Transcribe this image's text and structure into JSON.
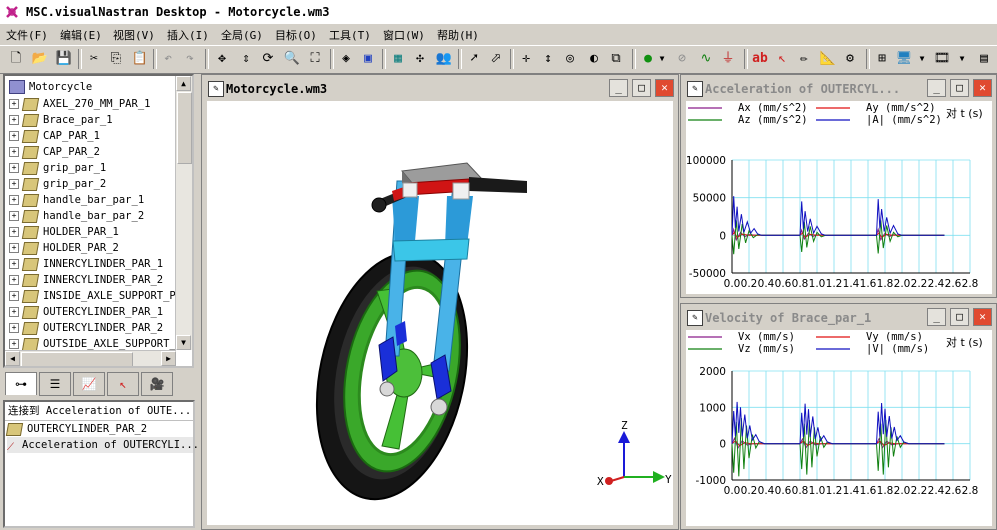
{
  "app": {
    "title": "MSC.visualNastran Desktop - Motorcycle.wm3"
  },
  "menu": [
    {
      "label": "文件(F)"
    },
    {
      "label": "编辑(E)"
    },
    {
      "label": "视图(V)"
    },
    {
      "label": "插入(I)"
    },
    {
      "label": "全局(G)"
    },
    {
      "label": "目标(O)"
    },
    {
      "label": "工具(T)"
    },
    {
      "label": "窗口(W)"
    },
    {
      "label": "帮助(H)"
    }
  ],
  "toolbar": {
    "icons": [
      "new-icon",
      "open-icon",
      "save-icon",
      "cut-icon",
      "copy-icon",
      "paste-icon",
      "undo-icon",
      "redo-icon",
      "move-icon",
      "pan-icon",
      "rotate-icon",
      "zoom-icon",
      "zoom-fit-icon",
      "render-icon",
      "box-icon",
      "grid-icon",
      "joint-icon",
      "people-icon",
      "pointer-icon",
      "select-icon",
      "translate-icon",
      "vertical-arrows-icon",
      "orbit-icon",
      "camera-icon",
      "frame-icon",
      "dot-icon",
      "hide-icon",
      "spring-icon",
      "constraint-icon",
      "text-icon",
      "arrow-icon",
      "measure-icon",
      "ruler-icon",
      "script-icon",
      "layout-icon",
      "screen-icon",
      "film-icon",
      "options-icon"
    ]
  },
  "tree": {
    "root": "Motorcycle",
    "items": [
      "AXEL_270_MM_PAR_1",
      "Brace_par_1",
      "CAP_PAR_1",
      "CAP_PAR_2",
      "grip_par_1",
      "grip_par_2",
      "handle_bar_par_1",
      "handle_bar_par_2",
      "HOLDER_PAR_1",
      "HOLDER_PAR_2",
      "INNERCYLINDER_PAR_1",
      "INNERCYLINDER_PAR_2",
      "INSIDE_AXLE_SUPPORT_PAR",
      "OUTERCYLINDER_PAR_1",
      "OUTERCYLINDER_PAR_2",
      "OUTSIDE_AXLE_SUPPORT_PAR"
    ]
  },
  "tabs": [
    "tree-tab",
    "list-tab",
    "graph-tab",
    "constraint-tab",
    "camera-tab"
  ],
  "connections": {
    "header": "连接到 Acceleration of OUTE...",
    "items": [
      {
        "label": "OUTERCYLINDER_PAR_2",
        "icon": "part-icon"
      },
      {
        "label": "Acceleration of OUTERCYLI...",
        "icon": "graph-icon"
      }
    ]
  },
  "viewport": {
    "title": "Motorcycle.wm3",
    "axis": {
      "x": "X",
      "y": "Y",
      "z": "Z"
    }
  },
  "colors": {
    "accent_red": "#e04a30",
    "series": [
      "#8b1c8b",
      "#e01010",
      "#108010",
      "#1010c0"
    ],
    "grid": "#80e0f0"
  },
  "chart_data": [
    {
      "type": "line",
      "window_title": "Acceleration of OUTERCYL...",
      "legend": [
        "Ax (mm/s^2)",
        "Ay (mm/s^2)",
        "Az (mm/s^2)",
        "|A| (mm/s^2)"
      ],
      "xlabel": "对 t (s)",
      "x_ticks": [
        "0.0",
        "0.2",
        "0.4",
        "0.6",
        "0.8",
        "1.0",
        "1.2",
        "1.4",
        "1.6",
        "1.8",
        "2.0",
        "2.2",
        "2.4",
        "2.6",
        "2.8"
      ],
      "y_ticks": [
        "100000",
        "50000",
        "0",
        "-50000"
      ],
      "ylim": [
        -50000,
        100000
      ],
      "xlim": [
        0,
        2.8
      ],
      "series": [
        {
          "name": "Ax (mm/s^2)",
          "values": [
            [
              0.0,
              0
            ],
            [
              0.02,
              8000
            ],
            [
              0.05,
              -6000
            ],
            [
              0.1,
              4000
            ],
            [
              0.15,
              -2000
            ],
            [
              0.2,
              1000
            ],
            [
              0.3,
              0
            ],
            [
              0.8,
              0
            ],
            [
              0.82,
              7000
            ],
            [
              0.85,
              -5000
            ],
            [
              0.9,
              3000
            ],
            [
              0.95,
              -1500
            ],
            [
              1.0,
              800
            ],
            [
              1.1,
              0
            ],
            [
              1.7,
              0
            ],
            [
              1.72,
              8000
            ],
            [
              1.75,
              -6000
            ],
            [
              1.8,
              3000
            ],
            [
              1.85,
              -1500
            ],
            [
              1.9,
              800
            ],
            [
              2.0,
              0
            ],
            [
              2.5,
              0
            ]
          ]
        },
        {
          "name": "Ay (mm/s^2)",
          "values": [
            [
              0.0,
              0
            ],
            [
              0.03,
              4000
            ],
            [
              0.06,
              -3000
            ],
            [
              0.12,
              1500
            ],
            [
              0.2,
              0
            ],
            [
              0.8,
              0
            ],
            [
              0.83,
              3000
            ],
            [
              0.86,
              -2500
            ],
            [
              0.92,
              1200
            ],
            [
              1.0,
              0
            ],
            [
              1.7,
              0
            ],
            [
              1.73,
              3000
            ],
            [
              1.76,
              -2500
            ],
            [
              1.82,
              1200
            ],
            [
              1.9,
              0
            ],
            [
              2.5,
              0
            ]
          ]
        },
        {
          "name": "Az (mm/s^2)",
          "values": [
            [
              0.0,
              0
            ],
            [
              0.02,
              -25000
            ],
            [
              0.05,
              20000
            ],
            [
              0.08,
              -18000
            ],
            [
              0.12,
              15000
            ],
            [
              0.16,
              -10000
            ],
            [
              0.2,
              6000
            ],
            [
              0.25,
              -3000
            ],
            [
              0.3,
              1000
            ],
            [
              0.35,
              0
            ],
            [
              0.8,
              0
            ],
            [
              0.82,
              -22000
            ],
            [
              0.85,
              18000
            ],
            [
              0.88,
              -16000
            ],
            [
              0.92,
              12000
            ],
            [
              0.96,
              -8000
            ],
            [
              1.0,
              4000
            ],
            [
              1.05,
              -2000
            ],
            [
              1.1,
              0
            ],
            [
              1.7,
              0
            ],
            [
              1.72,
              -24000
            ],
            [
              1.75,
              20000
            ],
            [
              1.78,
              -17000
            ],
            [
              1.82,
              13000
            ],
            [
              1.86,
              -8000
            ],
            [
              1.9,
              4000
            ],
            [
              1.95,
              -2000
            ],
            [
              2.0,
              0
            ],
            [
              2.5,
              0
            ]
          ]
        },
        {
          "name": "|A| (mm/s^2)",
          "values": [
            [
              0.0,
              0
            ],
            [
              0.02,
              52000
            ],
            [
              0.04,
              10000
            ],
            [
              0.06,
              38000
            ],
            [
              0.08,
              5000
            ],
            [
              0.11,
              28000
            ],
            [
              0.14,
              4000
            ],
            [
              0.18,
              18000
            ],
            [
              0.22,
              3000
            ],
            [
              0.26,
              9000
            ],
            [
              0.3,
              2000
            ],
            [
              0.35,
              0
            ],
            [
              0.8,
              0
            ],
            [
              0.82,
              45000
            ],
            [
              0.84,
              8000
            ],
            [
              0.86,
              32000
            ],
            [
              0.89,
              5000
            ],
            [
              0.92,
              22000
            ],
            [
              0.96,
              3000
            ],
            [
              1.0,
              12000
            ],
            [
              1.05,
              2000
            ],
            [
              1.1,
              0
            ],
            [
              1.7,
              0
            ],
            [
              1.72,
              48000
            ],
            [
              1.74,
              9000
            ],
            [
              1.76,
              35000
            ],
            [
              1.79,
              5000
            ],
            [
              1.82,
              24000
            ],
            [
              1.86,
              3000
            ],
            [
              1.9,
              13000
            ],
            [
              1.95,
              2000
            ],
            [
              2.0,
              0
            ],
            [
              2.5,
              0
            ]
          ]
        }
      ]
    },
    {
      "type": "line",
      "window_title": "Velocity of Brace_par_1",
      "legend": [
        "Vx (mm/s)",
        "Vy (mm/s)",
        "Vz (mm/s)",
        "|V| (mm/s)"
      ],
      "xlabel": "对 t (s)",
      "x_ticks": [
        "0.0",
        "0.2",
        "0.4",
        "0.6",
        "0.8",
        "1.0",
        "1.2",
        "1.4",
        "1.6",
        "1.8",
        "2.0",
        "2.2",
        "2.4",
        "2.6",
        "2.8"
      ],
      "y_ticks": [
        "2000",
        "1000",
        "0",
        "-1000"
      ],
      "ylim": [
        -1000,
        2000
      ],
      "xlim": [
        0,
        2.8
      ],
      "series": [
        {
          "name": "Vx (mm/s)",
          "values": [
            [
              0.0,
              0
            ],
            [
              0.03,
              150
            ],
            [
              0.07,
              -120
            ],
            [
              0.12,
              80
            ],
            [
              0.18,
              -40
            ],
            [
              0.25,
              0
            ],
            [
              0.8,
              0
            ],
            [
              0.83,
              130
            ],
            [
              0.87,
              -110
            ],
            [
              0.92,
              70
            ],
            [
              0.98,
              -30
            ],
            [
              1.05,
              0
            ],
            [
              1.7,
              0
            ],
            [
              1.73,
              140
            ],
            [
              1.77,
              -110
            ],
            [
              1.82,
              70
            ],
            [
              1.88,
              -30
            ],
            [
              1.95,
              0
            ],
            [
              2.5,
              0
            ]
          ]
        },
        {
          "name": "Vy (mm/s)",
          "values": [
            [
              0.0,
              0
            ],
            [
              0.04,
              80
            ],
            [
              0.09,
              -60
            ],
            [
              0.15,
              30
            ],
            [
              0.22,
              0
            ],
            [
              0.8,
              0
            ],
            [
              0.84,
              70
            ],
            [
              0.89,
              -50
            ],
            [
              0.95,
              25
            ],
            [
              1.02,
              0
            ],
            [
              1.7,
              0
            ],
            [
              1.74,
              70
            ],
            [
              1.79,
              -50
            ],
            [
              1.85,
              25
            ],
            [
              1.92,
              0
            ],
            [
              2.5,
              0
            ]
          ]
        },
        {
          "name": "Vz (mm/s)",
          "values": [
            [
              0.0,
              0
            ],
            [
              0.02,
              -800
            ],
            [
              0.05,
              600
            ],
            [
              0.08,
              -900
            ],
            [
              0.11,
              700
            ],
            [
              0.14,
              -700
            ],
            [
              0.17,
              500
            ],
            [
              0.2,
              -400
            ],
            [
              0.24,
              250
            ],
            [
              0.28,
              -120
            ],
            [
              0.32,
              50
            ],
            [
              0.38,
              0
            ],
            [
              0.8,
              0
            ],
            [
              0.82,
              -700
            ],
            [
              0.85,
              550
            ],
            [
              0.88,
              -850
            ],
            [
              0.91,
              650
            ],
            [
              0.94,
              -650
            ],
            [
              0.97,
              450
            ],
            [
              1.0,
              -350
            ],
            [
              1.04,
              200
            ],
            [
              1.08,
              -100
            ],
            [
              1.12,
              40
            ],
            [
              1.18,
              0
            ],
            [
              1.7,
              0
            ],
            [
              1.72,
              -750
            ],
            [
              1.75,
              550
            ],
            [
              1.78,
              -850
            ],
            [
              1.81,
              650
            ],
            [
              1.84,
              -650
            ],
            [
              1.87,
              450
            ],
            [
              1.9,
              -350
            ],
            [
              1.94,
              200
            ],
            [
              1.98,
              -100
            ],
            [
              2.02,
              40
            ],
            [
              2.08,
              0
            ],
            [
              2.5,
              0
            ]
          ]
        },
        {
          "name": "|V| (mm/s)",
          "values": [
            [
              0.0,
              0
            ],
            [
              0.02,
              900
            ],
            [
              0.04,
              200
            ],
            [
              0.06,
              1150
            ],
            [
              0.08,
              300
            ],
            [
              0.1,
              1000
            ],
            [
              0.12,
              200
            ],
            [
              0.15,
              800
            ],
            [
              0.18,
              150
            ],
            [
              0.21,
              500
            ],
            [
              0.24,
              100
            ],
            [
              0.28,
              250
            ],
            [
              0.32,
              60
            ],
            [
              0.38,
              0
            ],
            [
              0.8,
              0
            ],
            [
              0.82,
              850
            ],
            [
              0.84,
              180
            ],
            [
              0.86,
              1100
            ],
            [
              0.88,
              250
            ],
            [
              0.9,
              950
            ],
            [
              0.92,
              180
            ],
            [
              0.95,
              750
            ],
            [
              0.98,
              130
            ],
            [
              1.01,
              450
            ],
            [
              1.04,
              80
            ],
            [
              1.08,
              220
            ],
            [
              1.12,
              50
            ],
            [
              1.18,
              0
            ],
            [
              1.7,
              0
            ],
            [
              1.72,
              880
            ],
            [
              1.74,
              190
            ],
            [
              1.76,
              1120
            ],
            [
              1.78,
              260
            ],
            [
              1.8,
              960
            ],
            [
              1.82,
              190
            ],
            [
              1.85,
              760
            ],
            [
              1.88,
              140
            ],
            [
              1.91,
              460
            ],
            [
              1.94,
              90
            ],
            [
              1.98,
              220
            ],
            [
              2.02,
              50
            ],
            [
              2.08,
              0
            ],
            [
              2.5,
              0
            ]
          ]
        }
      ]
    }
  ]
}
